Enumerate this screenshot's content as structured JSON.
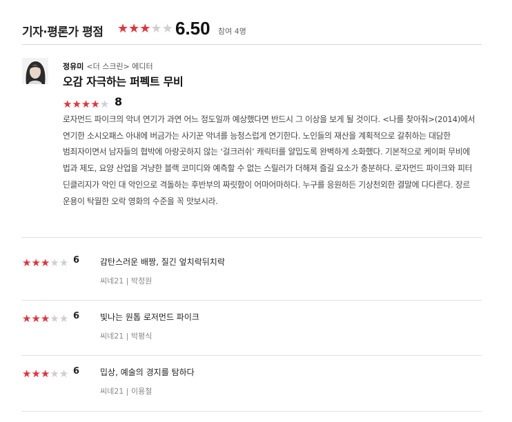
{
  "header": {
    "title": "기자·평론가 평점",
    "stars_on": 3,
    "stars_total": 5,
    "score": "6.50",
    "participants": "참여 4명"
  },
  "featured": {
    "author": "정유미",
    "outlet": "<더 스크린> 에디터",
    "title": "오감 자극하는 퍼펙트 무비",
    "stars_on": 4,
    "score": "8",
    "body": "로자먼드 파이크의 악녀 연기가 과연 어느 정도일까 예상했다면 반드시 그 이상을 보게 될 것이다. <나를 찾아줘>(2014)에서 연기한 소시오패스 아내에 버금가는 사기꾼 악녀를 능청스럽게 연기한다. 노인들의 재산을 계획적으로 갈취하는 대담한 범죄자이면서 남자들의 협박에 아랑곳하지 않는 ‘걸크러쉬’ 캐릭터를 얄밉도록 완벽하게 소화했다. 기본적으로 케이퍼 무비에 법과 제도, 요양 산업을 겨냥한 블랙 코미디와 예측할 수 없는 스릴러가 더해져 즐길 요소가 충분하다. 로자먼드 파이크와 피터 딘클리지가 악인 대 악인으로 격돌하는 후반부의 짜릿함이 어마어마하다. 누구를 응원하든 기상천외한 결말에 다다른다. 장르 운용이 탁월한 오락 영화의 수준을 꼭 맛보시라."
  },
  "reviews": [
    {
      "stars_on": 3,
      "score": "6",
      "title": "감탄스러운 배짱, 질긴 엎치락뒤치락",
      "source": "씨네21",
      "critic": "박정원"
    },
    {
      "stars_on": 3,
      "score": "6",
      "title": "빛나는 원톱 로저먼드 파이크",
      "source": "씨네21",
      "critic": "박평식"
    },
    {
      "stars_on": 3,
      "score": "6",
      "title": "밉상, 예술의 경지를 탐하다",
      "source": "씨네21",
      "critic": "이용철"
    }
  ],
  "colors": {
    "star_on": "#e8303a",
    "star_off": "#cfcfcf"
  }
}
